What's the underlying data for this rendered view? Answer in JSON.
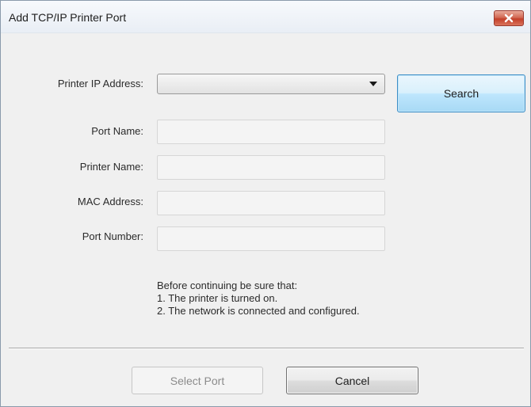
{
  "window": {
    "title": "Add TCP/IP Printer Port",
    "close_icon": "close-icon"
  },
  "form": {
    "ip_address": {
      "label": "Printer IP Address:",
      "value": ""
    },
    "port_name": {
      "label": "Port Name:",
      "value": ""
    },
    "printer_name": {
      "label": "Printer Name:",
      "value": ""
    },
    "mac_address": {
      "label": "MAC Address:",
      "value": ""
    },
    "port_number": {
      "label": "Port Number:",
      "value": ""
    }
  },
  "buttons": {
    "search": "Search",
    "select_port": "Select Port",
    "cancel": "Cancel"
  },
  "notice": {
    "heading": "Before continuing be sure that:",
    "items": [
      "1. The printer is turned on.",
      "2. The network is connected and configured."
    ]
  },
  "colors": {
    "close_button": "#c4402a",
    "search_button_border": "#3c8ec6",
    "window_background": "#f0f0f0"
  }
}
